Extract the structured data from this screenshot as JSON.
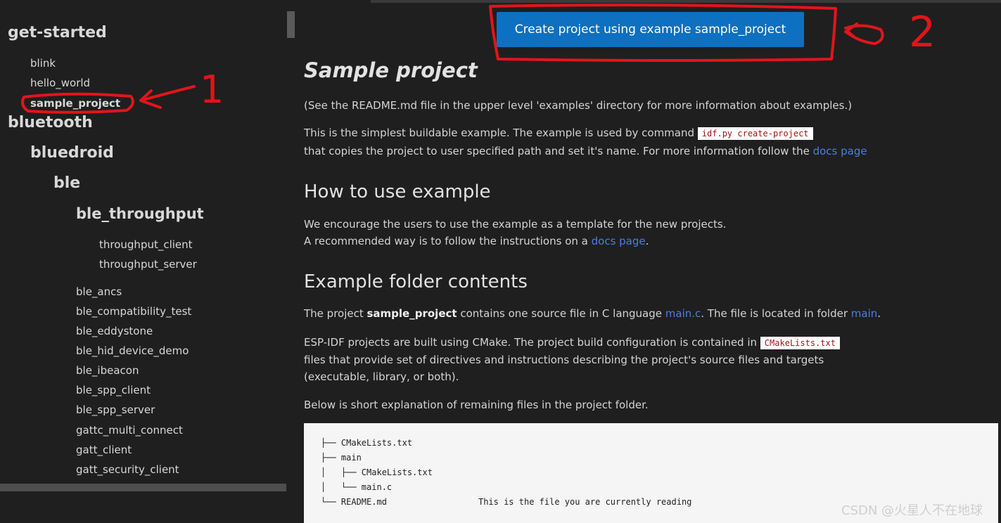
{
  "sidebar": {
    "get_started": "get-started",
    "blink": "blink",
    "hello_world": "hello_world",
    "sample_project": "sample_project",
    "bluetooth": "bluetooth",
    "bluedroid": "bluedroid",
    "ble": "ble",
    "ble_throughput": "ble_throughput",
    "throughput_client": "throughput_client",
    "throughput_server": "throughput_server",
    "ble_items": [
      "ble_ancs",
      "ble_compatibility_test",
      "ble_eddystone",
      "ble_hid_device_demo",
      "ble_ibeacon",
      "ble_spp_client",
      "ble_spp_server",
      "gattc_multi_connect",
      "gatt_client",
      "gatt_security_client"
    ]
  },
  "main": {
    "button_label": "Create project using example sample_project",
    "title": "Sample project",
    "readme_note": "(See the README.md file in the upper level 'examples' directory for more information about examples.)",
    "p1_a": "This is the simplest buildable example. The example is used by command ",
    "p1_code": "idf.py create-project",
    "p1_b": "that copies the project to user specified path and set it's name. For more information follow the ",
    "p1_link": "docs page",
    "h_howto": "How to use example",
    "howto_1": "We encourage the users to use the example as a template for the new projects.",
    "howto_2a": "A recommended way is to follow the instructions on a ",
    "howto_link": "docs page",
    "howto_2b": ".",
    "h_folder": "Example folder contents",
    "folder_a": "The project ",
    "folder_bold": "sample_project",
    "folder_b": " contains one source file in C language ",
    "folder_link1": "main.c",
    "folder_c": ". The file is located in folder ",
    "folder_link2": "main",
    "folder_d": ".",
    "cmake_a": "ESP-IDF projects are built using CMake. The project build configuration is contained in ",
    "cmake_code": "CMakeLists.txt",
    "cmake_b": "files that provide set of directives and instructions describing the project's source files and targets",
    "cmake_c": "(executable, library, or both).",
    "below": "Below is short explanation of remaining files in the project folder.",
    "tree": [
      "├── CMakeLists.txt",
      "├── main",
      "│   ├── CMakeLists.txt",
      "│   └── main.c",
      "└── README.md                  This is the file you are currently reading"
    ]
  },
  "annotations": {
    "label1": "1",
    "label2": "2",
    "color": "#e3141b"
  },
  "watermark": "CSDN @火星人不在地球",
  "colors": {
    "button": "#0e70c0",
    "link": "#4a7fe0",
    "code_text": "#a31515"
  }
}
